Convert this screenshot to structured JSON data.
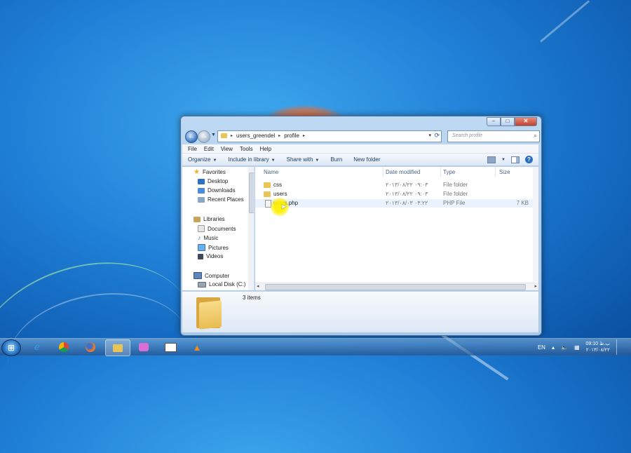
{
  "window": {
    "breadcrumbs": [
      "users_greendel",
      "profile"
    ],
    "search_placeholder": "Search profile",
    "menu": [
      "File",
      "Edit",
      "View",
      "Tools",
      "Help"
    ],
    "toolbar": {
      "organize": "Organize",
      "include_in_library": "Include in library",
      "share_with": "Share with",
      "burn": "Burn",
      "new_folder": "New folder"
    },
    "nav": {
      "favorites": "Favorites",
      "favorites_items": [
        "Desktop",
        "Downloads",
        "Recent Places"
      ],
      "libraries": "Libraries",
      "libraries_items": [
        "Documents",
        "Music",
        "Pictures",
        "Videos"
      ],
      "computer": "Computer",
      "computer_items": [
        "Local Disk (C:)"
      ]
    },
    "columns": {
      "name": "Name",
      "date": "Date modified",
      "type": "Type",
      "size": "Size"
    },
    "files": [
      {
        "name": "css",
        "date": "۲۰۱۳/۰۸/۲۲ ۰۹:۰۳",
        "type": "File folder",
        "size": ""
      },
      {
        "name": "users",
        "date": "۲۰۱۳/۰۸/۲۲ ۰۹:۰۳",
        "type": "File folder",
        "size": ""
      },
      {
        "name": "users.php",
        "date": "۲۰۱۳/۰۸/۰۳ ۰۴:۲۲",
        "type": "PHP File",
        "size": "7 KB"
      }
    ],
    "status": "3 items"
  },
  "taskbar": {
    "language": "EN",
    "time": "09:10 ب.ظ",
    "date": "۲۰۱۳/۰۸/۲۲"
  },
  "colors": {
    "selection": "#eaf3fd",
    "highlight_cursor": "#fff000"
  }
}
